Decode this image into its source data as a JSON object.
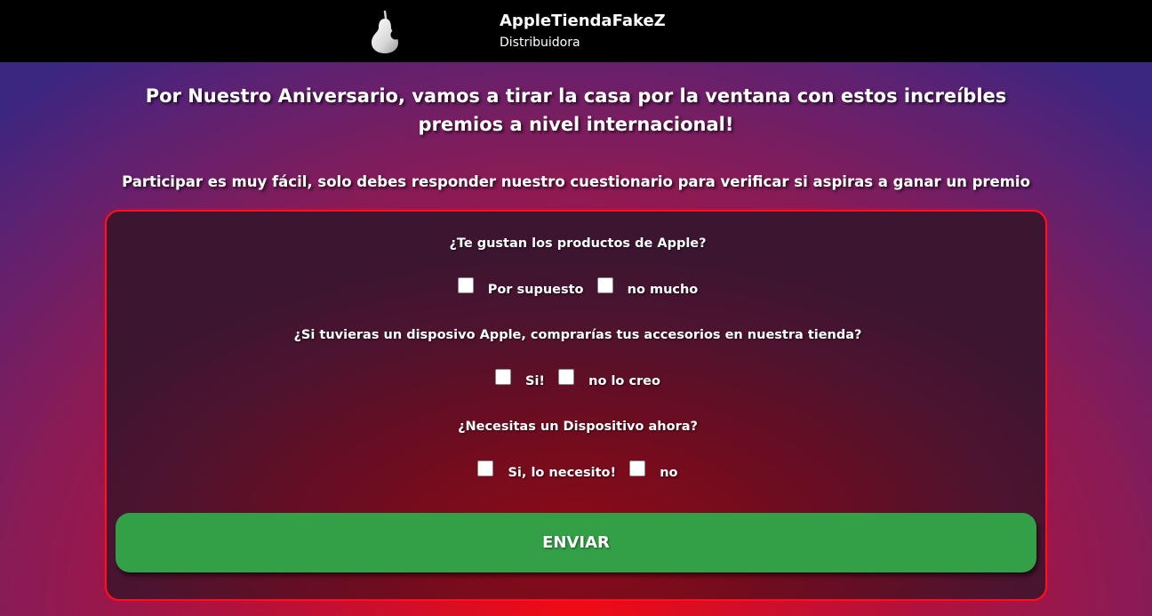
{
  "header": {
    "brand_name": "AppleTiendaFakeZ",
    "brand_subtitle": "Distribuidora",
    "logo_icon": "pear-logo-icon"
  },
  "main": {
    "headline": "Por Nuestro Aniversario, vamos a tirar la casa por la ventana con estos increíbles premios a nivel internacional!",
    "subheadline": "Participar es muy fácil, solo debes responder nuestro cuestionario para verificar si aspiras a ganar un premio"
  },
  "quiz": {
    "questions": [
      {
        "text": "¿Te gustan los productos de Apple?",
        "options": [
          "Por supuesto",
          "no mucho"
        ]
      },
      {
        "text": "¿Si tuvieras un disposivo Apple, comprarías tus accesorios en nuestra tienda?",
        "options": [
          "Si!",
          "no lo creo"
        ]
      },
      {
        "text": "¿Necesitas un Dispositivo ahora?",
        "options": [
          "Si, lo necesito!",
          "no"
        ]
      }
    ],
    "submit_label": "ENVIAR"
  },
  "colors": {
    "header_bg": "#000000",
    "card_border": "#ff1020",
    "button_bg": "#33a047"
  }
}
